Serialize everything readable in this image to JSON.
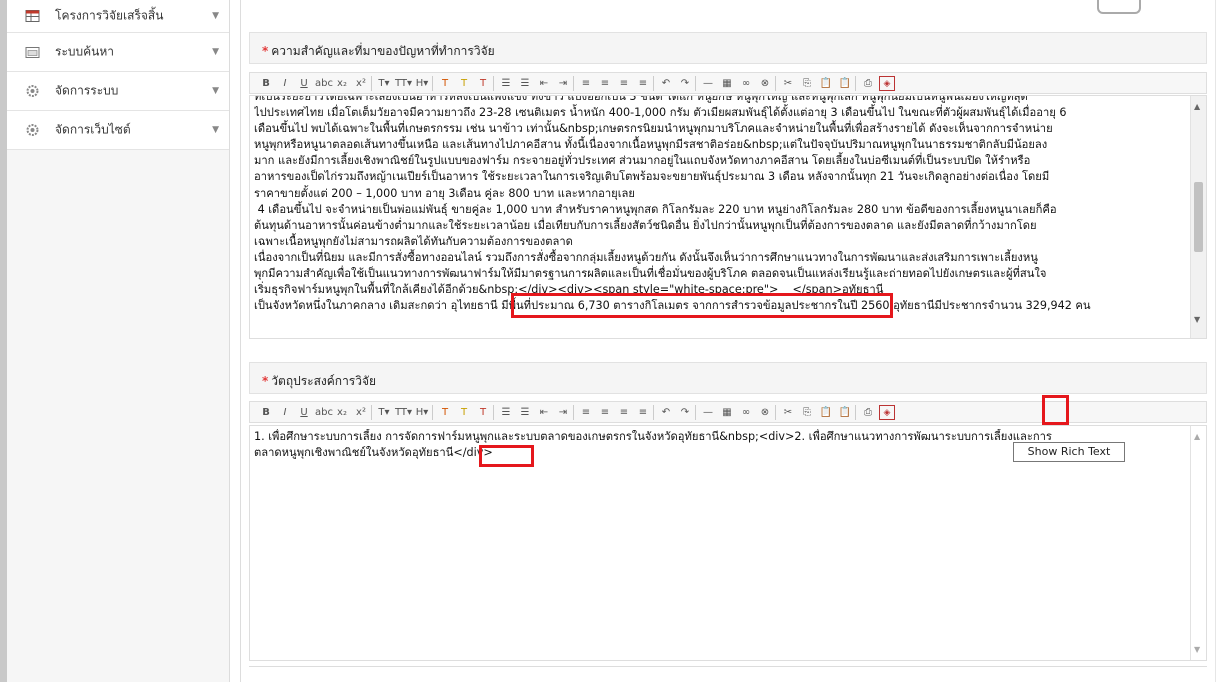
{
  "sidebar": {
    "items": [
      {
        "label": "โครงการวิจัยเสร็จสิ้น",
        "icon": "table-icon"
      },
      {
        "label": "ระบบค้นหา",
        "icon": "folder-icon"
      },
      {
        "label": "จัดการระบบ",
        "icon": "gear-icon"
      },
      {
        "label": "จัดการเว็บไซต์",
        "icon": "gear-icon"
      }
    ],
    "caret": "▼"
  },
  "sections": {
    "importance": {
      "title": "ความสำคัญและที่มาของปัญหาที่ทำการวิจัย",
      "required_mark": "*",
      "text": "ที่เป็นระยะยาวโดยเฉพาะเลี้ยงเป็นอาหารหลังเป็นแพงแข็ง ทั้งข้าว แบ่งออกเป็น 3 ชนิด ได้แก่ หนูยักษ์ หนูพุกใหญ่ และหนูพุกเล็ก หนูพุกนิยมเป็นหนูพื้นเมืองใหญ่ที่สุด\nไปประเทศไทย เมื่อโตเต็มวัยอาจมีความยาวถึง 23-28 เซนติเมตร น้ำหนัก 400-1,000 กรัม ตัวเมียผสมพันธุ์ได้ตั้งแต่อายุ 3 เดือนขึ้นไป ในขณะที่ตัวผู้ผสมพันธุ์ได้เมื่ออายุ 6\nเดือนขึ้นไป พบได้เฉพาะในพื้นที่เกษตรกรรม เช่น นาข้าว เท่านั้น&nbsp;เกษตรกรนิยมนำหนูพุกมาบริโภคและจำหน่ายในพื้นที่เพื่อสร้างรายได้ ดังจะเห็นจากการจำหน่าย\nหนูพุกหรือหนูนาตลอดเส้นทางขึ้นเหนือ และเส้นทางไปภาคอีสาน ทั้งนี้เนื่องจากเนื้อหนูพุกมีรสชาติอร่อย&nbsp;แต่ในปัจจุบันปริมาณหนูพุกในนาธรรมชาติกลับมีน้อยลง\nมาก และยังมีการเลี้ยงเชิงพาณิชย์ในรูปแบบของฟาร์ม กระจายอยู่ทั่วประเทศ ส่วนมากอยู่ในแถบจังหวัดทางภาคอีสาน โดยเลี้ยงในบ่อซีเมนต์ที่เป็นระบบปิด ให้รำหรือ\nอาหารของเป็ดไก่รวมถึงหญ้าเนเปียร์เป็นอาหาร ใช้ระยะเวลาในการเจริญเติบโตพร้อมจะขยายพันธุ์ประมาณ 3 เดือน หลังจากนั้นทุก 21 วันจะเกิดลูกอย่างต่อเนื่อง โดยมี\nราคาขายตั้งแต่ 200 – 1,000 บาท อายุ 3เดือน คู่ละ 800 บาท และหากอายุเลย\n 4 เดือนขึ้นไป จะจำหน่ายเป็นพ่อแม่พันธุ์ ขายคู่ละ 1,000 บาท สำหรับราคาหนูพุกสด กิโลกรัมละ 220 บาท หนูย่างกิโลกรัมละ 280 บาท ข้อดีของการเลี้ยงหนูนาเลยก็คือ\nต้นทุนด้านอาหารนั้นค่อนข้างต่ำมากและใช้ระยะเวลาน้อย เมื่อเทียบกับการเลี้ยงสัตว์ชนิดอื่น ยิ่งไปกว่านั้นหนูพุกเป็นที่ต้องการของตลาด และยังมีตลาดที่กว้างมากโดย\nเฉพาะเนื้อหนูพุกยังไม่สามารถผลิตได้ทันกับความต้องการของตลาด\nเนื่องจากเป็นที่นิยม และมีการสั่งซื้อทางออนไลน์ รวมถึงการสั่งซื้อจากกลุ่มเลี้ยงหนูด้วยกัน ดังนั้นจึงเห็นว่าการศึกษาแนวทางในการพัฒนาและส่งเสริมการเพาะเลี้ยงหนู\nพุกมีความสำคัญเพื่อใช้เป็นแนวทางการพัฒนาฟาร์มให้มีมาตรฐานการผลิตและเป็นที่เชื่อมั่นของผู้บริโภค ตลอดจนเป็นแหล่งเรียนรู้และถ่ายทอดไปยังเกษตรและผู้ที่สนใจ\nเริ่มธุรกิจฟาร์มหนูพุกในพื้นที่ใกล้เคียงได้อีกด้วย&nbsp;</div><div><span style=\"white-space:pre\">    </span>อุทัยธานี\nเป็นจังหวัดหนึ่งในภาคกลาง เดิมสะกดว่า อุไทยธานี มีพื้นที่ประมาณ 6,730 ตารางกิโลเมตร จากการสำรวจข้อมูลประชากรในปี 2560 อุทัยธานีมีประชากรจำนวน 329,942 คน"
    },
    "objective": {
      "title": "วัตถุประสงค์การวิจัย",
      "required_mark": "*",
      "text": "1. เพื่อศึกษาระบบการเลี้ยง การจัดการฟาร์มหนูพุกและระบบตลาดของเกษตรกรในจังหวัดอุทัยธานี&nbsp;<div>2. เพื่อศึกษาแนวทางการพัฒนาระบบการเลี้ยงและการ\nตลาดหนูพุกเชิงพาณิชย์ในจังหวัดอุทัยธานี</div>"
    }
  },
  "toolbar": {
    "buttons": [
      {
        "name": "bold-button",
        "label": "B"
      },
      {
        "name": "italic-button",
        "label": "I"
      },
      {
        "name": "underline-button",
        "label": "U"
      },
      {
        "name": "strikethrough-button",
        "label": "abc"
      },
      {
        "name": "subscript-button",
        "label": "x₂"
      },
      {
        "name": "superscript-button",
        "label": "x²"
      },
      {
        "name": "font-size-button",
        "label": "T▾"
      },
      {
        "name": "font-family-button",
        "label": "TT▾"
      },
      {
        "name": "heading-button",
        "label": "H▾"
      },
      {
        "name": "font-color-button",
        "label": "T"
      },
      {
        "name": "highlight-button",
        "label": "T"
      },
      {
        "name": "clear-format-button",
        "label": "T"
      },
      {
        "name": "bullet-list-button",
        "label": "☰"
      },
      {
        "name": "numbered-list-button",
        "label": "☰"
      },
      {
        "name": "outdent-button",
        "label": "⇤"
      },
      {
        "name": "indent-button",
        "label": "⇥"
      },
      {
        "name": "align-left-button",
        "label": "≡"
      },
      {
        "name": "align-center-button",
        "label": "≡"
      },
      {
        "name": "align-right-button",
        "label": "≡"
      },
      {
        "name": "justify-button",
        "label": "≡"
      },
      {
        "name": "undo-button",
        "label": "↶"
      },
      {
        "name": "redo-button",
        "label": "↷"
      },
      {
        "name": "hr-button",
        "label": "—"
      },
      {
        "name": "table-button",
        "label": "▦"
      },
      {
        "name": "link-button",
        "label": "∞"
      },
      {
        "name": "unlink-button",
        "label": "⊗"
      },
      {
        "name": "cut-button",
        "label": "✂"
      },
      {
        "name": "copy-button",
        "label": "⎘"
      },
      {
        "name": "paste-button",
        "label": "📋"
      },
      {
        "name": "paste-text-button",
        "label": "📋"
      },
      {
        "name": "print-button",
        "label": "⎙"
      },
      {
        "name": "show-rich-text-button",
        "label": "◈"
      }
    ]
  },
  "tooltip": {
    "text": "Show Rich Text"
  },
  "colors": {
    "accent_red": "#e5171c",
    "required": "#e23a3a"
  }
}
